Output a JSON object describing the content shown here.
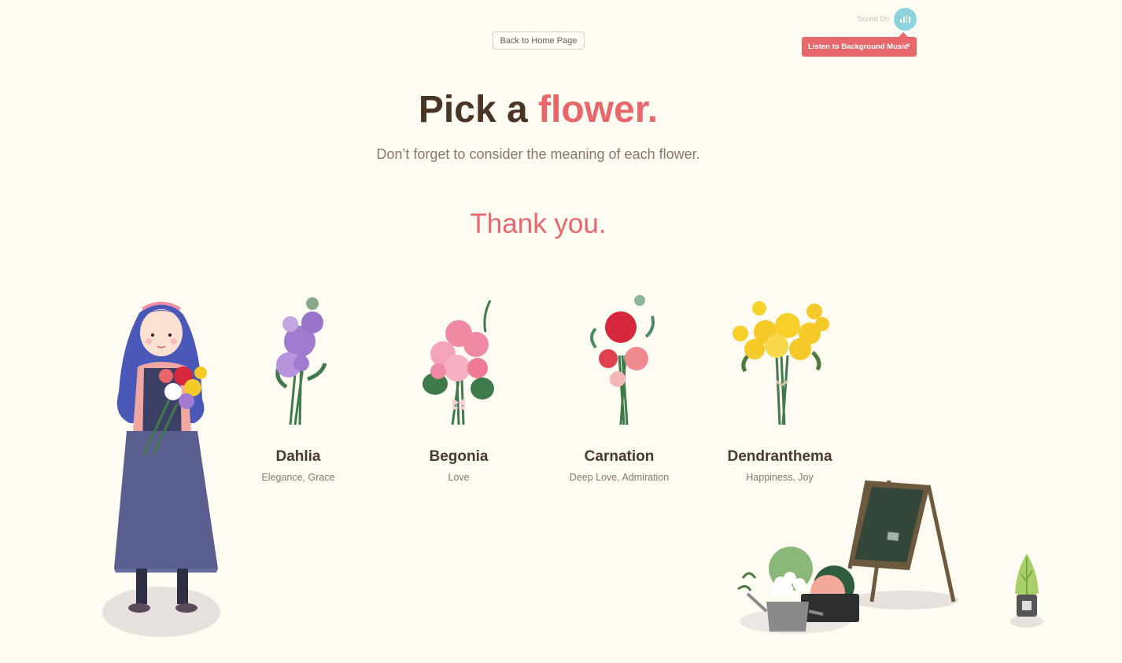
{
  "header": {
    "home_label": "Back to Home Page",
    "sound_label": "Sound On",
    "tooltip_text": "Listen to Background Music",
    "tooltip_close": "×"
  },
  "main": {
    "title_part1": "Pick a",
    "title_part2": "flower.",
    "subtitle": "Don’t forget to consider the meaning of each flower.",
    "thanks": "Thank you."
  },
  "flowers": [
    {
      "name": "Dahlia",
      "meaning": "Elegance, Grace",
      "icon": "dahlia-bouquet-icon",
      "color": "#a07bcf"
    },
    {
      "name": "Begonia",
      "meaning": "Love",
      "icon": "begonia-bouquet-icon",
      "color": "#f08aa4"
    },
    {
      "name": "Carnation",
      "meaning": "Deep Love, Admiration",
      "icon": "carnation-bouquet-icon",
      "color": "#d8283e"
    },
    {
      "name": "Dendranthema",
      "meaning": "Happiness, Joy",
      "icon": "dendranthema-bouquet-icon",
      "color": "#f5c928"
    }
  ],
  "colors": {
    "background": "#fefbf3",
    "accent": "#e8676a",
    "sound_button": "#8dd3dd",
    "title": "#4a3424"
  }
}
